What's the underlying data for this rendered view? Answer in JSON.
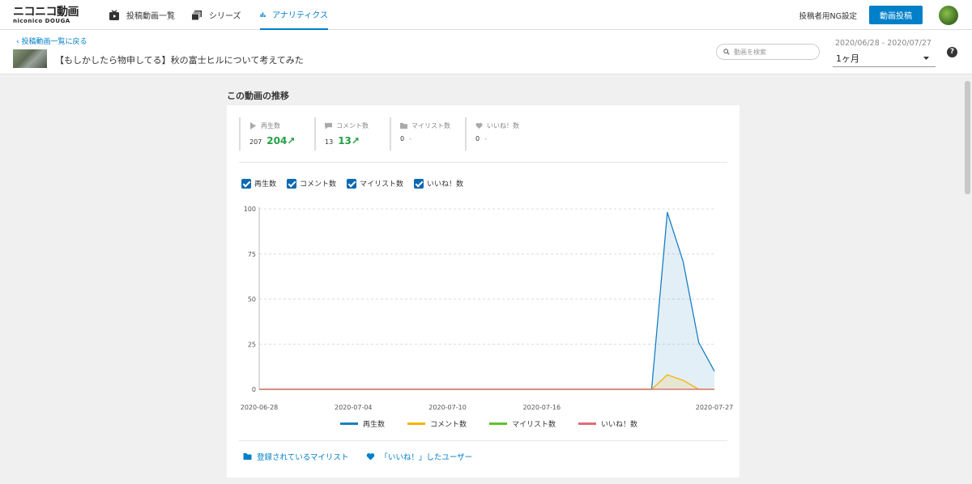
{
  "header": {
    "logo_line1": "ニコニコ動画",
    "logo_line2": "niconico DOUGA",
    "nav": [
      {
        "label": "投稿動画一覧",
        "icon": "tv-icon"
      },
      {
        "label": "シリーズ",
        "icon": "stack-icon"
      },
      {
        "label": "アナリティクス",
        "icon": "bar-chart-icon",
        "active": true
      }
    ],
    "ng_settings": "投稿者用NG設定",
    "upload_button": "動画投稿"
  },
  "subheader": {
    "back_link": "投稿動画一覧に戻る",
    "video_title": "【もしかしたら物申してる】秋の富士ヒルについて考えてみた",
    "search_placeholder": "動画を検索",
    "date_range": "2020/06/28 - 2020/07/27",
    "period": "1ヶ月",
    "help": "?"
  },
  "main": {
    "section_title": "この動画の推移",
    "stats": [
      {
        "label": "再生数",
        "icon": "play-icon",
        "prev": "207",
        "current": "204↗",
        "dash": ""
      },
      {
        "label": "コメント数",
        "icon": "comment-icon",
        "prev": "13",
        "current": "13↗",
        "dash": ""
      },
      {
        "label": "マイリスト数",
        "icon": "folder-icon",
        "prev": "0",
        "current": "",
        "dash": "-"
      },
      {
        "label": "いいね！数",
        "icon": "heart-icon",
        "prev": "0",
        "current": "",
        "dash": "-"
      }
    ],
    "checkboxes": [
      {
        "label": "再生数",
        "checked": true
      },
      {
        "label": "コメント数",
        "checked": true
      },
      {
        "label": "マイリスト数",
        "checked": true
      },
      {
        "label": "いいね！数",
        "checked": true
      }
    ],
    "links": {
      "mylist": "登録されているマイリスト",
      "likes": "「いいね！」したユーザー"
    }
  },
  "colors": {
    "accent": "#0080c8",
    "views": "#1a7fc1",
    "comments": "#f5b400",
    "mylist": "#5cc42b",
    "likes": "#e26b78",
    "positive": "#22a046"
  },
  "chart_data": {
    "type": "area",
    "x": [
      "2020-06-28",
      "2020-06-29",
      "2020-06-30",
      "2020-07-01",
      "2020-07-02",
      "2020-07-03",
      "2020-07-04",
      "2020-07-05",
      "2020-07-06",
      "2020-07-07",
      "2020-07-08",
      "2020-07-09",
      "2020-07-10",
      "2020-07-11",
      "2020-07-12",
      "2020-07-13",
      "2020-07-14",
      "2020-07-15",
      "2020-07-16",
      "2020-07-17",
      "2020-07-18",
      "2020-07-19",
      "2020-07-20",
      "2020-07-21",
      "2020-07-22",
      "2020-07-23",
      "2020-07-24",
      "2020-07-25",
      "2020-07-26",
      "2020-07-27"
    ],
    "x_tick_labels": [
      "2020-06-28",
      "2020-07-04",
      "2020-07-10",
      "2020-07-16",
      "2020-07-27"
    ],
    "y_ticks": [
      0,
      25,
      50,
      75,
      100
    ],
    "ylim": [
      0,
      100
    ],
    "grid": true,
    "legend_position": "bottom",
    "series": [
      {
        "name": "再生数",
        "color": "#1a7fc1",
        "values": [
          0,
          0,
          0,
          0,
          0,
          0,
          0,
          0,
          0,
          0,
          0,
          0,
          0,
          0,
          0,
          0,
          0,
          0,
          0,
          0,
          0,
          0,
          0,
          0,
          0,
          0,
          98,
          71,
          26,
          10
        ]
      },
      {
        "name": "コメント数",
        "color": "#f5b400",
        "values": [
          0,
          0,
          0,
          0,
          0,
          0,
          0,
          0,
          0,
          0,
          0,
          0,
          0,
          0,
          0,
          0,
          0,
          0,
          0,
          0,
          0,
          0,
          0,
          0,
          0,
          0,
          8,
          5,
          0,
          0
        ]
      },
      {
        "name": "マイリスト数",
        "color": "#5cc42b",
        "values": [
          0,
          0,
          0,
          0,
          0,
          0,
          0,
          0,
          0,
          0,
          0,
          0,
          0,
          0,
          0,
          0,
          0,
          0,
          0,
          0,
          0,
          0,
          0,
          0,
          0,
          0,
          0,
          0,
          0,
          0
        ]
      },
      {
        "name": "いいね！数",
        "color": "#e26b78",
        "values": [
          0,
          0,
          0,
          0,
          0,
          0,
          0,
          0,
          0,
          0,
          0,
          0,
          0,
          0,
          0,
          0,
          0,
          0,
          0,
          0,
          0,
          0,
          0,
          0,
          0,
          0,
          0,
          0,
          0,
          0
        ]
      }
    ]
  }
}
